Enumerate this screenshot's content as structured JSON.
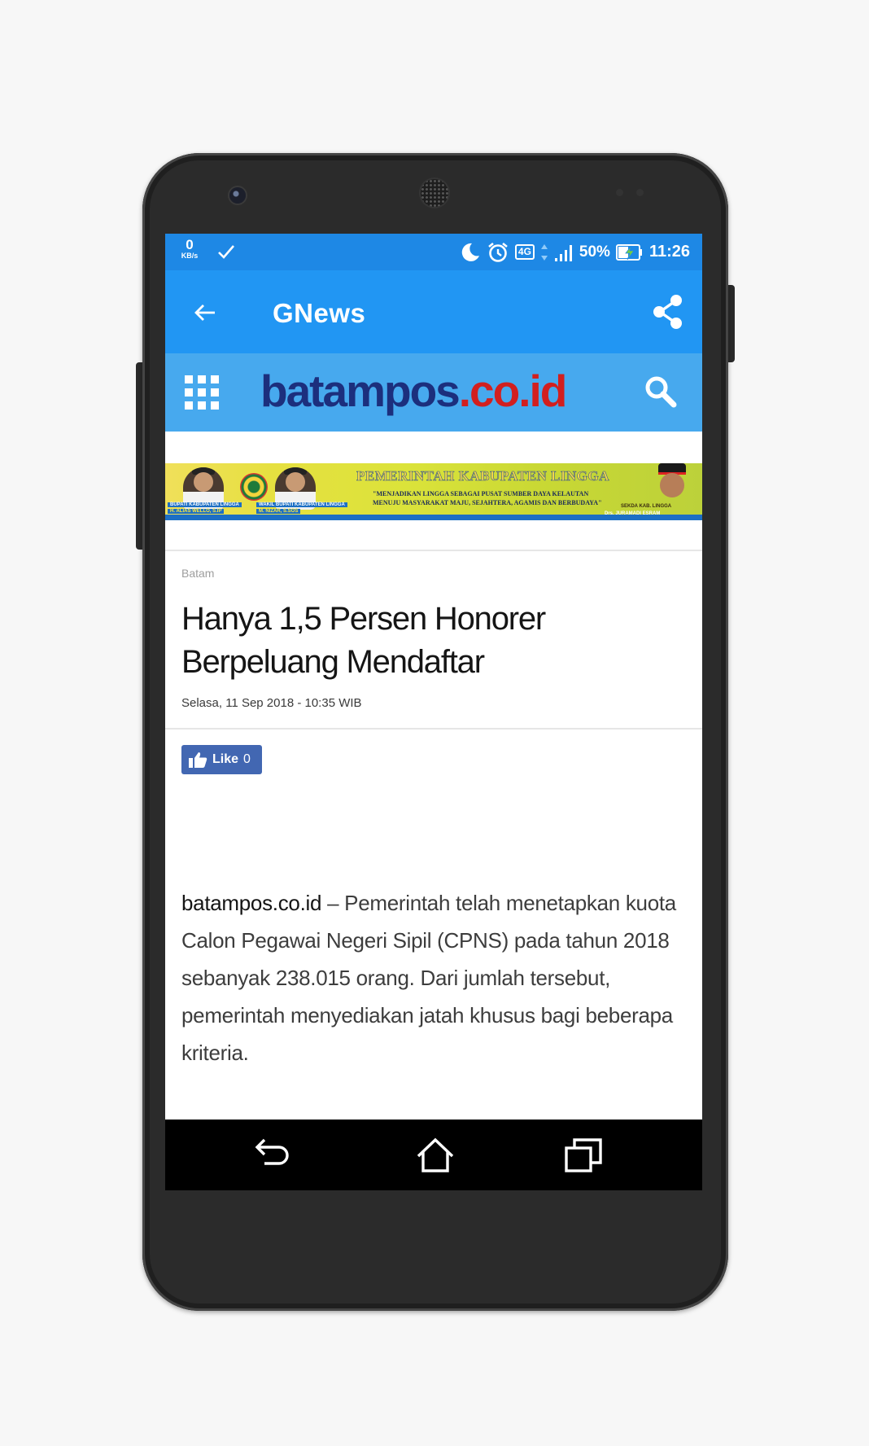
{
  "status_bar": {
    "net_speed_value": "0",
    "net_speed_unit": "KB/s",
    "network_type": "4G",
    "battery_percent": "50%",
    "time": "11:26"
  },
  "app_bar": {
    "title": "GNews"
  },
  "site_bar": {
    "logo_main": "batampos",
    "logo_suffix": ".co.id"
  },
  "banner": {
    "title": "PEMERINTAH KABUPATEN LINGGA",
    "tagline_1": "\"MENJADIKAN LINGGA SEBAGAI PUSAT SUMBER DAYA KELAUTAN",
    "tagline_2": "MENUJU MASYARAKAT MAJU, SEJAHTERA, AGAMIS DAN BERBUDAYA\"",
    "left_role": "BUPATI KABUPATEN LINGGA",
    "left_name": "H. ALIAS WELLO, S.IP",
    "mid_role": "WAKIL BUPATI KABUPATEN LINGGA",
    "mid_name": "M. NIZAR, S.SOS",
    "right_role": "SEKDA KAB. LINGGA",
    "right_name": "Drs. JURAMADI ESRAM"
  },
  "article": {
    "category": "Batam",
    "headline": "Hanya 1,5 Persen Honorer Berpeluang Mendaftar",
    "date": "Selasa, 11 Sep 2018 - 10:35 WIB",
    "like_label": "Like",
    "like_count": "0",
    "body_source": "batampos.co.id",
    "body_text": " – Pemerintah telah menetapkan kuota Calon Pegawai Negeri Sipil (CPNS) pada tahun 2018 sebanyak 238.015 orang. Dari jumlah tersebut, pemerintah menyediakan jatah khusus bagi beberapa kriteria."
  },
  "colors": {
    "status_bar": "#1e88e5",
    "app_bar": "#2196f3",
    "site_bar": "#47a9ee",
    "logo_blue": "#1c2f7d",
    "logo_red": "#d21f1f",
    "like_button": "#4267b2"
  }
}
